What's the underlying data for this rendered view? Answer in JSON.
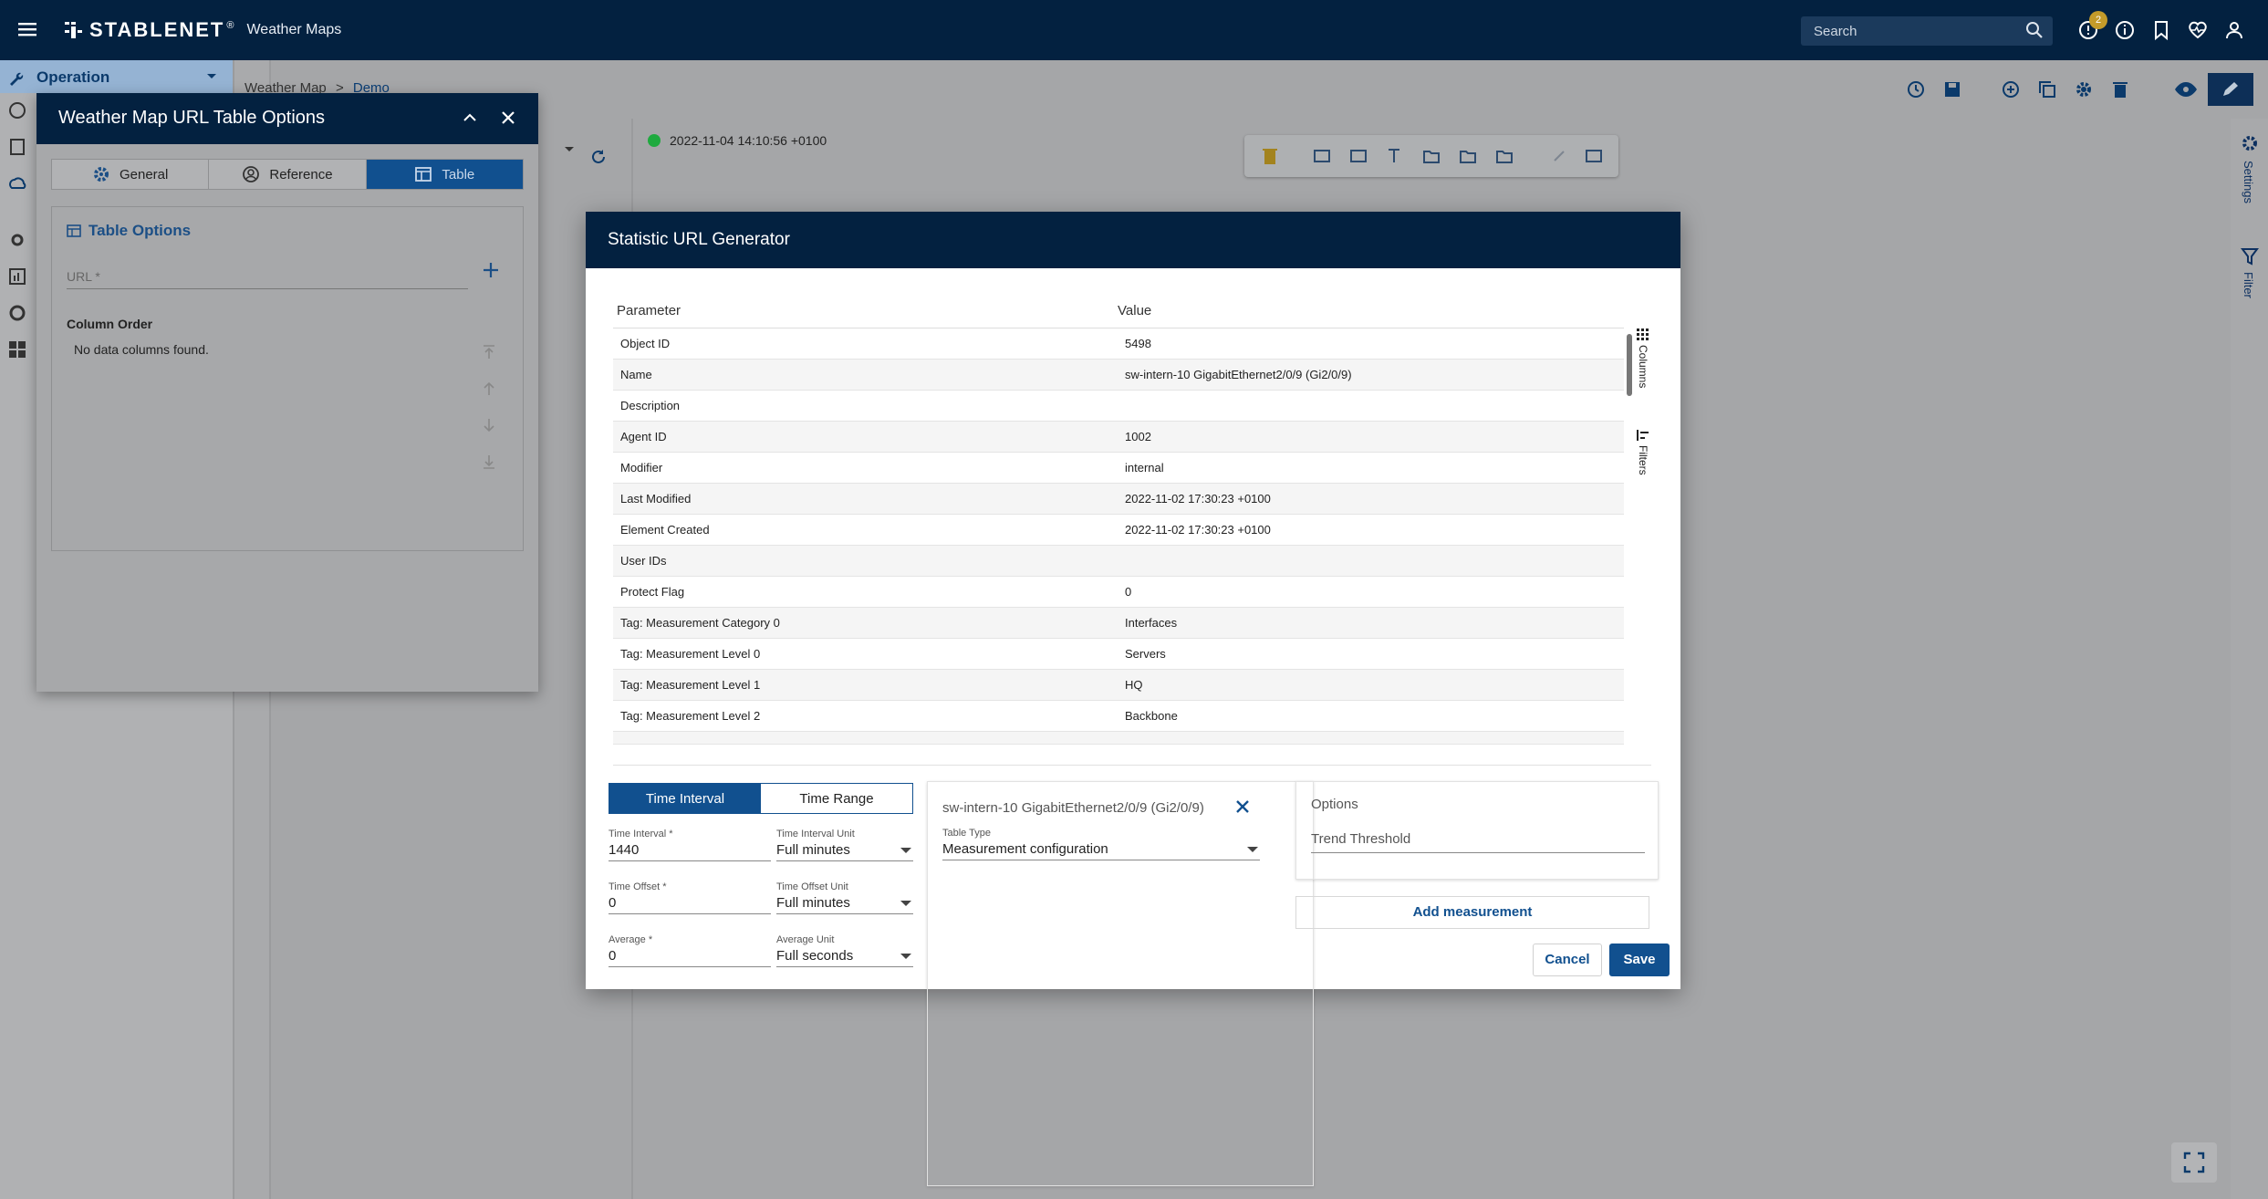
{
  "topbar": {
    "brand": "STABLENET",
    "trademark": "®",
    "app_name": "Weather Maps",
    "search_placeholder": "Search",
    "notification_count": "2"
  },
  "nav": {
    "operation_label": "Operation"
  },
  "breadcrumb": {
    "root": "Weather Map",
    "current": "Demo"
  },
  "status": {
    "timestamp": "2022-11-04 14:10:56 +0100",
    "color": "#1faa3f"
  },
  "rail": {
    "settings": "Settings",
    "filter": "Filter"
  },
  "url_dialog": {
    "title": "Weather Map URL Table Options",
    "tabs": [
      {
        "label": "General",
        "icon": "gear-icon"
      },
      {
        "label": "Reference",
        "icon": "user-circle-icon"
      },
      {
        "label": "Table",
        "icon": "table-icon"
      }
    ],
    "section_title": "Table Options",
    "url_placeholder": "URL *",
    "column_order_label": "Column Order",
    "no_columns": "No data columns found."
  },
  "modal": {
    "title": "Statistic URL Generator",
    "headers": {
      "parameter": "Parameter",
      "value": "Value"
    },
    "rows": [
      {
        "p": "Object ID",
        "v": "5498"
      },
      {
        "p": "Name",
        "v": "sw-intern-10 GigabitEthernet2/0/9 (Gi2/0/9)"
      },
      {
        "p": "Description",
        "v": ""
      },
      {
        "p": "Agent ID",
        "v": "1002"
      },
      {
        "p": "Modifier",
        "v": "internal"
      },
      {
        "p": "Last Modified",
        "v": "2022-11-02 17:30:23 +0100"
      },
      {
        "p": "Element Created",
        "v": "2022-11-02 17:30:23 +0100"
      },
      {
        "p": "User IDs",
        "v": ""
      },
      {
        "p": "Protect Flag",
        "v": "0"
      },
      {
        "p": "Tag: Measurement Category 0",
        "v": "Interfaces"
      },
      {
        "p": "Tag: Measurement Level 0",
        "v": "Servers"
      },
      {
        "p": "Tag: Measurement Level 1",
        "v": "HQ"
      },
      {
        "p": "Tag: Measurement Level 2",
        "v": "Backbone"
      }
    ],
    "side_columns": "Columns",
    "side_filters": "Filters",
    "time_toggle": {
      "interval": "Time Interval",
      "range": "Time Range"
    },
    "fields": {
      "time_interval": {
        "label": "Time Interval *",
        "value": "1440"
      },
      "time_interval_unit": {
        "label": "Time Interval Unit",
        "value": "Full minutes"
      },
      "time_offset": {
        "label": "Time Offset *",
        "value": "0"
      },
      "time_offset_unit": {
        "label": "Time Offset Unit",
        "value": "Full minutes"
      },
      "average": {
        "label": "Average *",
        "value": "0"
      },
      "average_unit": {
        "label": "Average Unit",
        "value": "Full seconds"
      }
    },
    "measurement": {
      "name": "sw-intern-10 GigabitEthernet2/0/9 (Gi2/0/9)",
      "table_type_label": "Table Type",
      "table_type_value": "Measurement configuration"
    },
    "options": {
      "title": "Options",
      "trend_threshold": "Trend Threshold"
    },
    "add_measurement": "Add measurement",
    "cancel": "Cancel",
    "save": "Save"
  }
}
